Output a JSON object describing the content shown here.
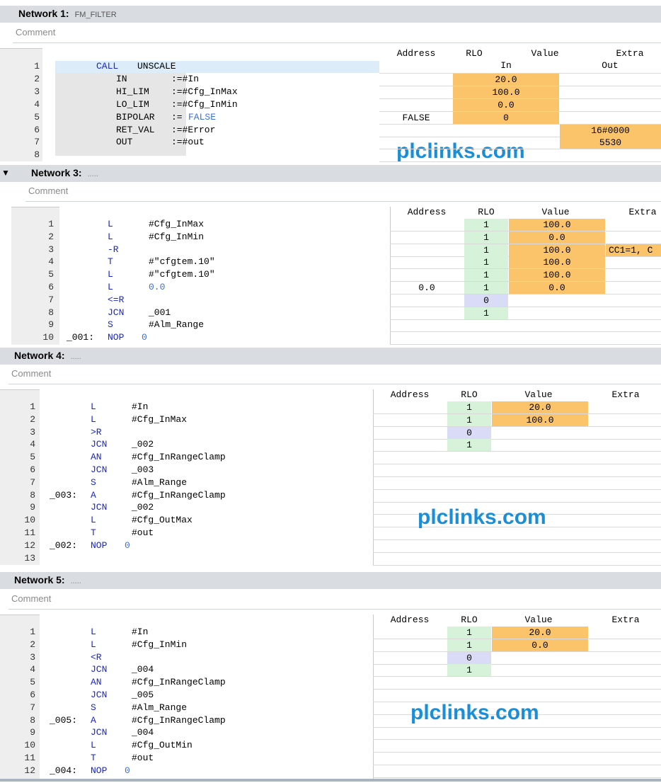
{
  "colors": {
    "rlo_true": "#d6f2d9",
    "rlo_false": "#d9dbf7",
    "value": "#fbc46b",
    "header": "#d9dde2",
    "watermark": "#1a8fd8",
    "keyword": "#1a26c9"
  },
  "watermark": "plclinks.com",
  "comment_label": "Comment",
  "network1": {
    "title": "Network 1:",
    "subtitle": "FM_FILTER",
    "columns": {
      "address": "Address",
      "rlo": "RLO",
      "value": "Value",
      "extra": "Extra"
    },
    "subcols": {
      "in": "In",
      "out": "Out"
    },
    "lines": [
      "1",
      "2",
      "3",
      "4",
      "5",
      "6",
      "7",
      "8"
    ],
    "code": [
      {
        "a": "CALL",
        "b": "UNSCALE"
      },
      {
        "a": "IN",
        "b": ":=#In"
      },
      {
        "a": "HI_LIM",
        "b": ":=#Cfg_InMax"
      },
      {
        "a": "LO_LIM",
        "b": ":=#Cfg_InMin"
      },
      {
        "a": "BIPOLAR",
        "b": ":=",
        "c": "FALSE"
      },
      {
        "a": "RET_VAL",
        "b": ":=#Error"
      },
      {
        "a": "OUT",
        "b": ":=#out"
      }
    ],
    "address_vals": [
      "FALSE"
    ],
    "in_vals": [
      "20.0",
      "100.0",
      "0.0",
      "0"
    ],
    "out_vals": [
      "16#0000",
      "5530"
    ]
  },
  "network3": {
    "title": "Network 3:",
    "dots": ".....",
    "columns": {
      "address": "Address",
      "rlo": "RLO",
      "value": "Value",
      "extra": "Extra"
    },
    "lines": [
      "1",
      "2",
      "3",
      "4",
      "5",
      "6",
      "7",
      "8",
      "9",
      "10"
    ],
    "code": [
      {
        "op": "L",
        "arg": "#Cfg_InMax"
      },
      {
        "op": "L",
        "arg": "#Cfg_InMin"
      },
      {
        "op": "-R",
        "arg": ""
      },
      {
        "op": "T",
        "arg": "#\"cfgtem.10\""
      },
      {
        "op": "L",
        "arg": "#\"cfgtem.10\""
      },
      {
        "op": "L",
        "arg": "0.0"
      },
      {
        "op": "<=R",
        "arg": ""
      },
      {
        "op": "JCN",
        "arg": "_001"
      },
      {
        "op": "S",
        "arg": "#Alm_Range"
      },
      {
        "label": "_001:",
        "op": "NOP",
        "arg": "0"
      }
    ],
    "address_vals": [
      "0.0"
    ],
    "rlo": [
      "1",
      "1",
      "1",
      "1",
      "1",
      "1",
      "0",
      "1"
    ],
    "values": [
      "100.0",
      "0.0",
      "100.0",
      "100.0",
      "100.0",
      "0.0"
    ],
    "extra": "CC1=1, C"
  },
  "network4": {
    "title": "Network 4:",
    "dots": ".....",
    "columns": {
      "address": "Address",
      "rlo": "RLO",
      "value": "Value",
      "extra": "Extra"
    },
    "lines": [
      "1",
      "2",
      "3",
      "4",
      "5",
      "6",
      "7",
      "8",
      "9",
      "10",
      "11",
      "12",
      "13"
    ],
    "code": [
      {
        "op": "L",
        "arg": "#In"
      },
      {
        "op": "L",
        "arg": "#Cfg_InMax"
      },
      {
        "op": ">R",
        "arg": ""
      },
      {
        "op": "JCN",
        "arg": "_002"
      },
      {
        "op": "AN",
        "arg": "#Cfg_InRangeClamp"
      },
      {
        "op": "JCN",
        "arg": "_003"
      },
      {
        "op": "S",
        "arg": "#Alm_Range"
      },
      {
        "label": "_003:",
        "op": "A",
        "arg": "#Cfg_InRangeClamp"
      },
      {
        "op": "JCN",
        "arg": "_002"
      },
      {
        "op": "L",
        "arg": "#Cfg_OutMax"
      },
      {
        "op": "T",
        "arg": "#out"
      },
      {
        "label": "_002:",
        "op": "NOP",
        "arg": "0"
      }
    ],
    "rlo": [
      "1",
      "1",
      "0",
      "1"
    ],
    "values": [
      "20.0",
      "100.0"
    ]
  },
  "network5": {
    "title": "Network 5:",
    "dots": ".....",
    "columns": {
      "address": "Address",
      "rlo": "RLO",
      "value": "Value",
      "extra": "Extra"
    },
    "lines": [
      "1",
      "2",
      "3",
      "4",
      "5",
      "6",
      "7",
      "8",
      "9",
      "10",
      "11",
      "12"
    ],
    "code": [
      {
        "op": "L",
        "arg": "#In"
      },
      {
        "op": "L",
        "arg": "#Cfg_InMin"
      },
      {
        "op": "<R",
        "arg": ""
      },
      {
        "op": "JCN",
        "arg": "_004"
      },
      {
        "op": "AN",
        "arg": "#Cfg_InRangeClamp"
      },
      {
        "op": "JCN",
        "arg": "_005"
      },
      {
        "op": "S",
        "arg": "#Alm_Range"
      },
      {
        "label": "_005:",
        "op": "A",
        "arg": "#Cfg_InRangeClamp"
      },
      {
        "op": "JCN",
        "arg": "_004"
      },
      {
        "op": "L",
        "arg": "#Cfg_OutMin"
      },
      {
        "op": "T",
        "arg": "#out"
      },
      {
        "label": "_004:",
        "op": "NOP",
        "arg": "0"
      }
    ],
    "rlo": [
      "1",
      "1",
      "0",
      "1"
    ],
    "values": [
      "20.0",
      "0.0"
    ]
  }
}
